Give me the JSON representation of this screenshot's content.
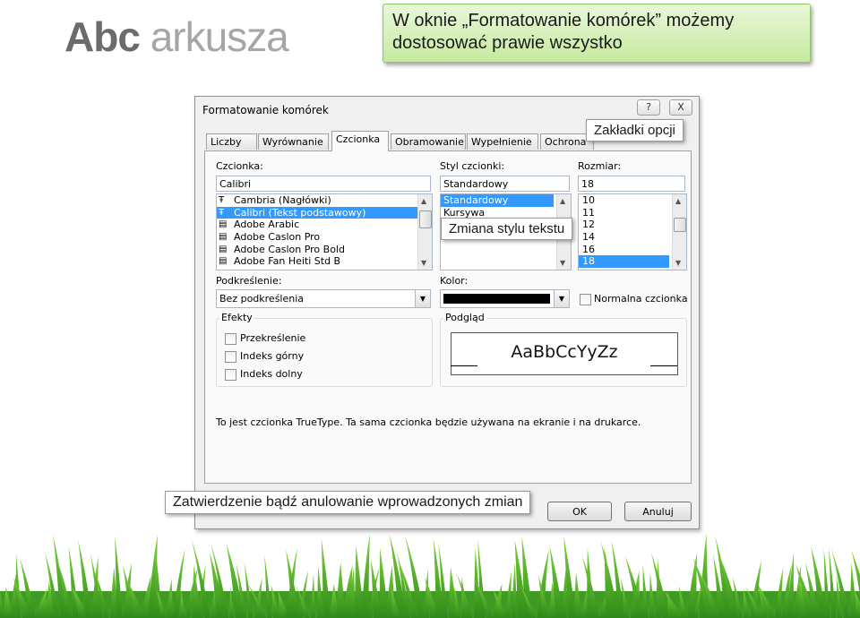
{
  "slide": {
    "title_bold": "Abc",
    "title_light": "arkusza",
    "callout_line1": "W oknie „Formatowanie komórek” możemy",
    "callout_line2": "dostosować prawie wszystko"
  },
  "dialog": {
    "title": "Formatowanie komórek",
    "help_label": "?",
    "close_label": "X",
    "tabs": [
      "Liczby",
      "Wyrównanie",
      "Czcionka",
      "Obramowanie",
      "Wypełnienie",
      "Ochrona"
    ],
    "active_tab": "Czcionka",
    "font": {
      "label": "Czcionka:",
      "value": "Calibri",
      "items": [
        "Cambria (Nagłówki)",
        "Calibri (Tekst podstawowy)",
        "Adobe Arabic",
        "Adobe Caslon Pro",
        "Adobe Caslon Pro Bold",
        "Adobe Fan Heiti Std B"
      ],
      "selected_index": 1
    },
    "style": {
      "label": "Styl czcionki:",
      "value": "Standardowy",
      "items": [
        "Standardowy",
        "Kursywa"
      ],
      "selected_index": 0
    },
    "size": {
      "label": "Rozmiar:",
      "value": "18",
      "items": [
        "10",
        "11",
        "12",
        "14",
        "16",
        "18"
      ],
      "selected_index": 5
    },
    "underline": {
      "label": "Podkreślenie:",
      "value": "Bez podkreślenia"
    },
    "color": {
      "label": "Kolor:",
      "swatch": "#000000"
    },
    "normal_font": {
      "label": "Normalna czcionka",
      "checked": false
    },
    "effects": {
      "label": "Efekty",
      "strikethrough": {
        "label": "Przekreślenie",
        "checked": false
      },
      "superscript": {
        "label": "Indeks górny",
        "checked": false
      },
      "subscript": {
        "label": "Indeks dolny",
        "checked": false
      }
    },
    "preview": {
      "label": "Podgląd",
      "sample": "AaBbCcYyZz"
    },
    "info": "To jest czcionka TrueType. Ta sama czcionka będzie używana na ekranie i na drukarce.",
    "ok_label": "OK",
    "cancel_label": "Anuluj"
  },
  "annotations": {
    "tabs_note": "Zakładki opcji",
    "style_note": "Zmiana stylu tekstu",
    "confirm_note": "Zatwierdzenie bądź anulowanie wprowadzonych zmian"
  }
}
